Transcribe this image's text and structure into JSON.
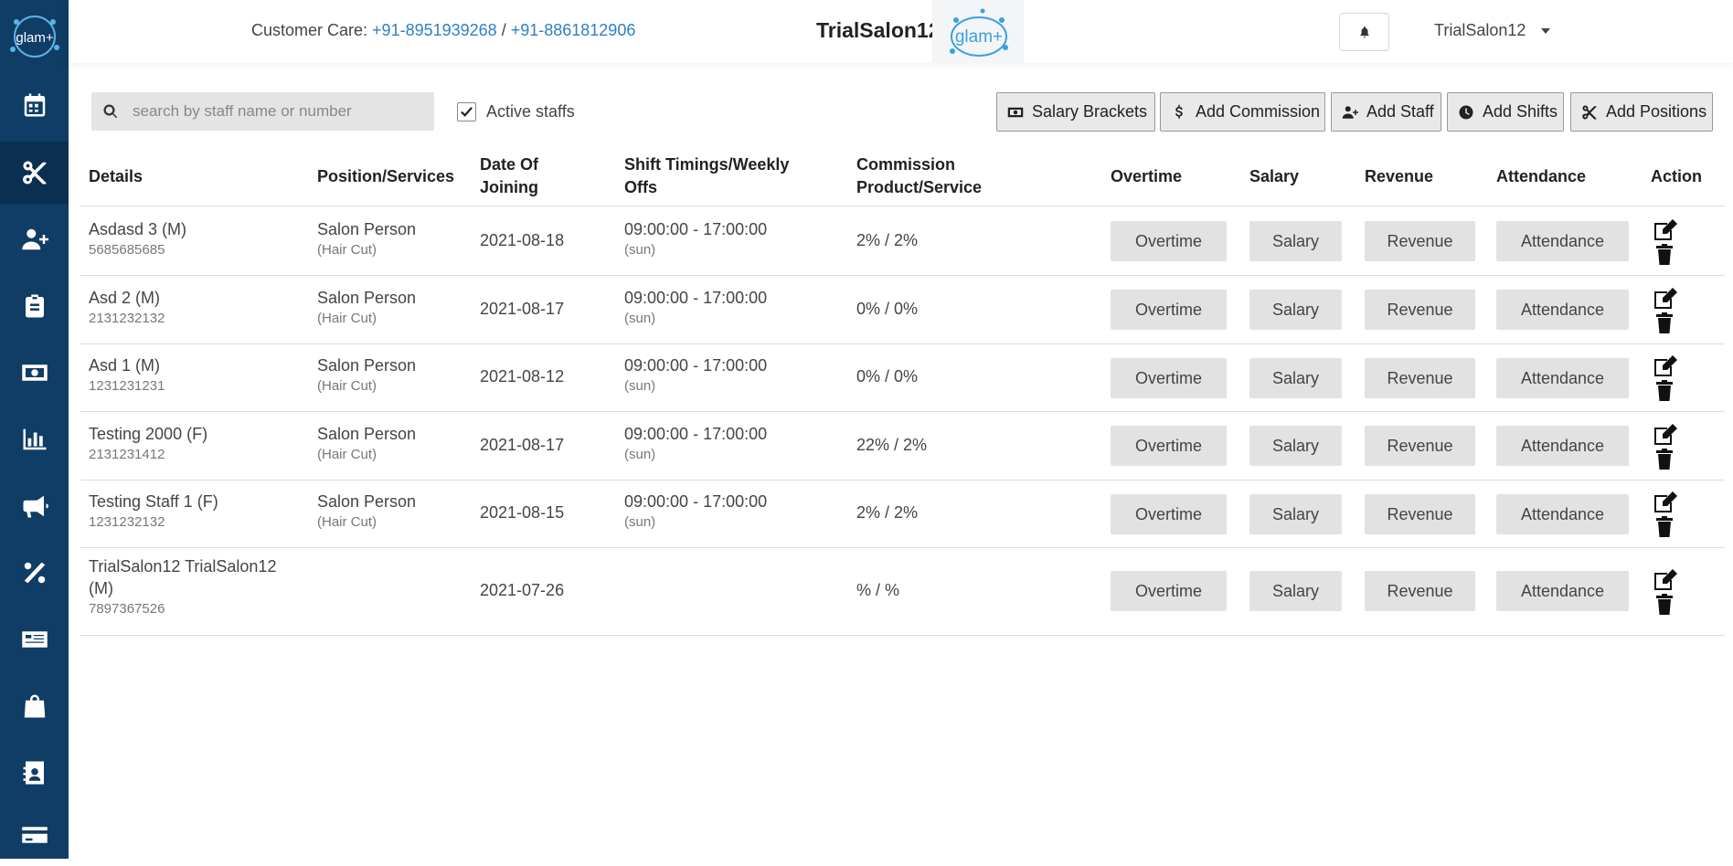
{
  "sidebar": {
    "logo_text": "glam+",
    "items": [
      {
        "icon": "calendar-icon"
      },
      {
        "icon": "scissors-icon",
        "active": true
      },
      {
        "icon": "add-user-icon"
      },
      {
        "icon": "clipboard-icon"
      },
      {
        "icon": "money-icon"
      },
      {
        "icon": "chart-icon"
      },
      {
        "icon": "megaphone-icon"
      },
      {
        "icon": "percent-icon"
      },
      {
        "icon": "newspaper-icon"
      },
      {
        "icon": "shopping-bag-icon"
      },
      {
        "icon": "contact-book-icon"
      },
      {
        "icon": "credit-card-icon"
      }
    ]
  },
  "header": {
    "care_label": "Customer Care: ",
    "phone1": "+91-8951939268",
    "separator": " / ",
    "phone2": "+91-8861812906",
    "salon_name": "TrialSalon12",
    "logo_text": "glam+",
    "user_name": "TrialSalon12"
  },
  "toolbar": {
    "search_placeholder": "search by staff name or number",
    "active_label": "Active staffs",
    "active_checked": true,
    "buttons": {
      "salary_brackets": "Salary Brackets",
      "add_commission": "Add Commission",
      "add_staff": "Add Staff",
      "add_shifts": "Add Shifts",
      "add_positions": "Add Positions"
    }
  },
  "table": {
    "headers": {
      "details": "Details",
      "position": "Position/Services",
      "doj_1": "Date Of",
      "doj_2": "Joining",
      "shift_1": "Shift Timings/Weekly",
      "shift_2": "Offs",
      "comm_1": "Commission",
      "comm_2": "Product/Service",
      "overtime": "Overtime",
      "salary": "Salary",
      "revenue": "Revenue",
      "attendance": "Attendance",
      "action": "Action"
    },
    "button_labels": {
      "overtime": "Overtime",
      "salary": "Salary",
      "revenue": "Revenue",
      "attendance": "Attendance"
    },
    "rows": [
      {
        "name": "Asdasd 3 (M)",
        "phone": "5685685685",
        "position": "Salon Person",
        "services": "(Hair Cut)",
        "doj": "2021-08-18",
        "shift": "09:00:00 - 17:00:00",
        "off": "(sun)",
        "commission": "2% / 2%"
      },
      {
        "name": "Asd 2 (M)",
        "phone": "2131232132",
        "position": "Salon Person",
        "services": "(Hair Cut)",
        "doj": "2021-08-17",
        "shift": "09:00:00 - 17:00:00",
        "off": "(sun)",
        "commission": "0% / 0%"
      },
      {
        "name": "Asd 1 (M)",
        "phone": "1231231231",
        "position": "Salon Person",
        "services": "(Hair Cut)",
        "doj": "2021-08-12",
        "shift": "09:00:00 - 17:00:00",
        "off": "(sun)",
        "commission": "0% / 0%"
      },
      {
        "name": "Testing 2000 (F)",
        "phone": "2131231412",
        "position": "Salon Person",
        "services": "(Hair Cut)",
        "doj": "2021-08-17",
        "shift": "09:00:00 - 17:00:00",
        "off": "(sun)",
        "commission": "22% / 2%"
      },
      {
        "name": "Testing Staff 1 (F)",
        "phone": "1231232132",
        "position": "Salon Person",
        "services": "(Hair Cut)",
        "doj": "2021-08-15",
        "shift": "09:00:00 - 17:00:00",
        "off": "(sun)",
        "commission": "2% / 2%"
      },
      {
        "name_1": "TrialSalon12 TrialSalon12",
        "name_2": "(M)",
        "phone": "7897367526",
        "doj": "2021-07-26",
        "commission": "% / %"
      }
    ]
  }
}
